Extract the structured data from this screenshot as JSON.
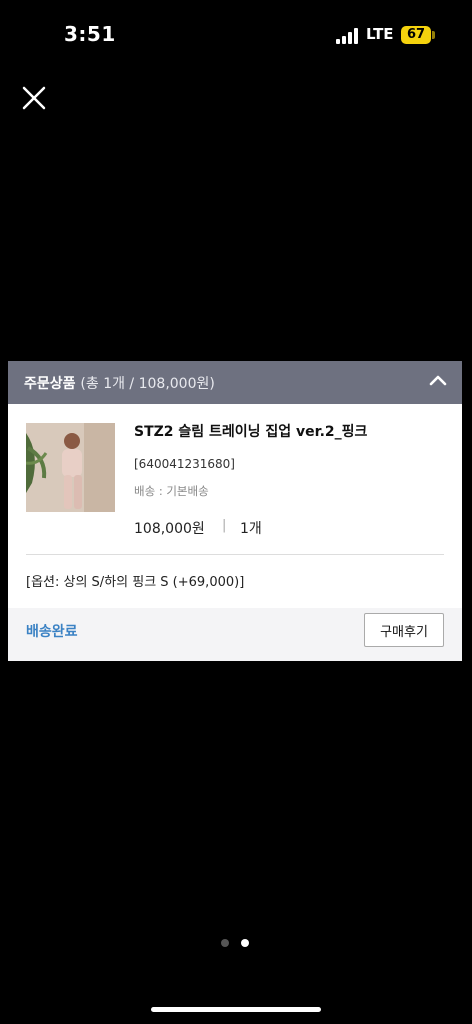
{
  "status_bar": {
    "time": "3:51",
    "network": "LTE",
    "battery": "67"
  },
  "order": {
    "section_title": "주문상품",
    "summary": "(총 1개 / 108,000원)",
    "product": {
      "name": "STZ2 슬림 트레이닝 집업 ver.2_핑크",
      "code": "[640041231680]",
      "shipping": "배송 : 기본배송",
      "price": "108,000원",
      "separator": "|",
      "quantity": "1개",
      "option": "[옵션: 상의 S/하의 핑크 S (+69,000)]"
    },
    "status": "배송완료",
    "review_button": "구매후기"
  },
  "pager": {
    "total": 2,
    "active_index": 1
  },
  "colors": {
    "header_bg": "#6e7180",
    "status_link": "#3b82c4",
    "battery": "#f5d20d",
    "footer_bg": "#f4f4f6"
  },
  "icons": [
    "close-icon",
    "chevron-up-icon",
    "signal-icon",
    "battery-icon"
  ]
}
